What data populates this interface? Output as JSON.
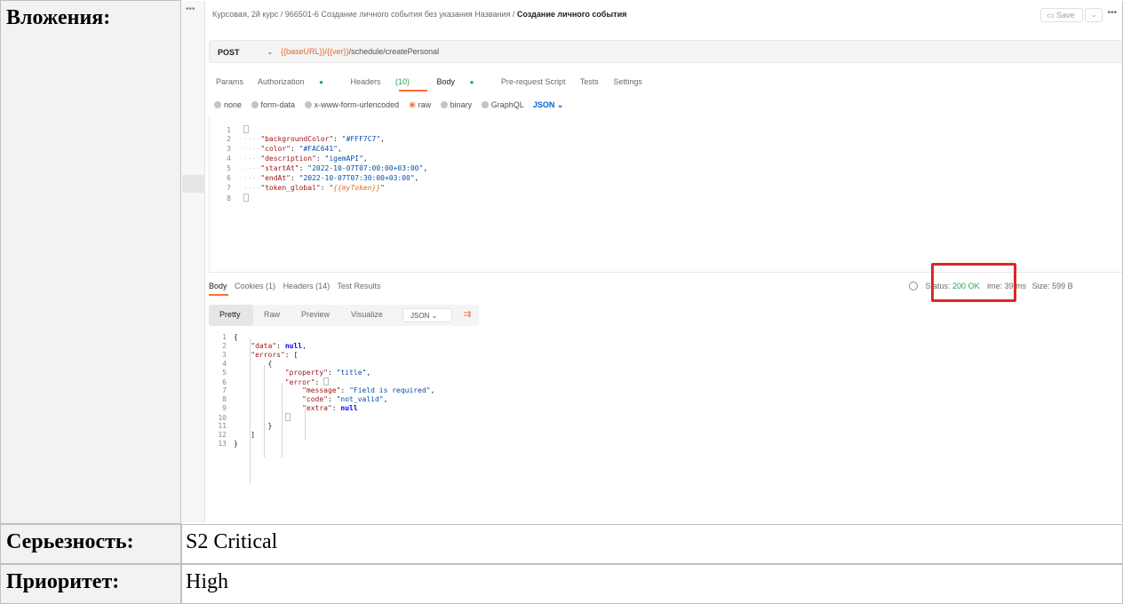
{
  "doc": {
    "attachments_label": "Вложения:",
    "severity_label": "Серьезность:",
    "severity_value": "S2 Critical",
    "priority_label": "Приоритет:",
    "priority_value": "High"
  },
  "postman": {
    "sidebar_dots": "•••",
    "breadcrumb": {
      "prefix": "Курсовая, 2й курс / 966501-6 Создание личного события без указания Названия / ",
      "current": "Создание личного события"
    },
    "save_label": "Save",
    "more_label": "•••",
    "method": "POST",
    "url_vars": "{{baseURL}}/{{ver}}",
    "url_path": "/schedule/createPersonal",
    "req_tabs": {
      "params": "Params",
      "authorization": "Authorization",
      "headers": "Headers",
      "headers_count": "(10)",
      "body": "Body",
      "prerequest": "Pre-request Script",
      "tests": "Tests",
      "settings": "Settings"
    },
    "body_options": {
      "none": "none",
      "form_data": "form-data",
      "urlencoded": "x-www-form-urlencoded",
      "raw": "raw",
      "binary": "binary",
      "graphql": "GraphQL",
      "json": "JSON"
    },
    "request_lines": [
      {
        "n": "1",
        "indent": "",
        "k": "",
        "v": "",
        "tmpl": "",
        "p": "{"
      },
      {
        "n": "2",
        "indent": "····",
        "k": "\"backgroundColor\"",
        "v": "\"#FFF7C7\"",
        "tmpl": "",
        "p": ","
      },
      {
        "n": "3",
        "indent": "····",
        "k": "\"color\"",
        "v": "\"#FAC641\"",
        "tmpl": "",
        "p": ","
      },
      {
        "n": "4",
        "indent": "····",
        "k": "\"description\"",
        "v": "\"igemAPI\"",
        "tmpl": "",
        "p": ","
      },
      {
        "n": "5",
        "indent": "····",
        "k": "\"startAt\"",
        "v": "\"2022-10-07T07:00:00+03:00\"",
        "tmpl": "",
        "p": ","
      },
      {
        "n": "6",
        "indent": "····",
        "k": "\"endAt\"",
        "v": "\"2022-10-07T07:30:00+03:00\"",
        "tmpl": "",
        "p": ","
      },
      {
        "n": "7",
        "indent": "····",
        "k": "\"token_global\"",
        "v": "\"",
        "tmpl": "{{myToken}}",
        "p": "\""
      },
      {
        "n": "8",
        "indent": "",
        "k": "",
        "v": "",
        "tmpl": "",
        "p": "}"
      }
    ],
    "resp_tabs": {
      "body": "Body",
      "cookies": "Cookies (1)",
      "headers": "Headers (14)",
      "tests": "Test Results"
    },
    "status": {
      "status_label": "Status:",
      "status_value": "200 OK",
      "time": "ime: 39 ms",
      "size": "Size: 599 B"
    },
    "view": {
      "pretty": "Pretty",
      "raw": "Raw",
      "preview": "Preview",
      "visualize": "Visualize",
      "format": "JSON"
    },
    "response_lines": [
      {
        "n": "1",
        "pad": "",
        "k": "",
        "v": "",
        "kw": "",
        "p": "{"
      },
      {
        "n": "2",
        "pad": "    ",
        "k": "\"data\"",
        "v": "",
        "kw": "null",
        "p": ","
      },
      {
        "n": "3",
        "pad": "    ",
        "k": "\"errors\"",
        "v": "",
        "kw": "",
        "p": "["
      },
      {
        "n": "4",
        "pad": "        ",
        "k": "",
        "v": "",
        "kw": "",
        "p": "{"
      },
      {
        "n": "5",
        "pad": "            ",
        "k": "\"property\"",
        "v": "\"title\"",
        "kw": "",
        "p": ","
      },
      {
        "n": "6",
        "pad": "            ",
        "k": "\"error\"",
        "v": "",
        "kw": "",
        "p": "{"
      },
      {
        "n": "7",
        "pad": "                ",
        "k": "\"message\"",
        "v": "\"Field is required\"",
        "kw": "",
        "p": ","
      },
      {
        "n": "8",
        "pad": "                ",
        "k": "\"code\"",
        "v": "\"not_valid\"",
        "kw": "",
        "p": ","
      },
      {
        "n": "9",
        "pad": "                ",
        "k": "\"extra\"",
        "v": "",
        "kw": "null",
        "p": ""
      },
      {
        "n": "10",
        "pad": "            ",
        "k": "",
        "v": "",
        "kw": "",
        "p": "}"
      },
      {
        "n": "11",
        "pad": "        ",
        "k": "",
        "v": "",
        "kw": "",
        "p": "}"
      },
      {
        "n": "12",
        "pad": "    ",
        "k": "",
        "v": "",
        "kw": "",
        "p": "]"
      },
      {
        "n": "13",
        "pad": "",
        "k": "",
        "v": "",
        "kw": "",
        "p": "}"
      }
    ]
  }
}
